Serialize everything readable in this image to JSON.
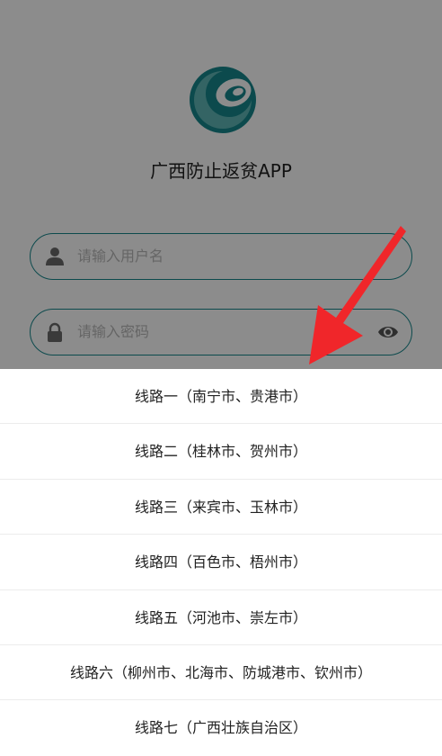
{
  "app": {
    "title": "广西防止返贫APP",
    "logo_icon": "app-logo-icon",
    "brand_color": "#17888c"
  },
  "login": {
    "username_placeholder": "请输入用户名",
    "password_placeholder": "请输入密码",
    "username_icon": "user-icon",
    "password_icon": "lock-icon",
    "visibility_icon": "eye-icon"
  },
  "route_sheet": {
    "items": [
      {
        "label": "线路一（南宁市、贵港市）"
      },
      {
        "label": "线路二（桂林市、贺州市）"
      },
      {
        "label": "线路三（来宾市、玉林市）"
      },
      {
        "label": "线路四（百色市、梧州市）"
      },
      {
        "label": "线路五（河池市、崇左市）"
      },
      {
        "label": "线路六（柳州市、北海市、防城港市、钦州市）"
      },
      {
        "label": "线路七（广西壮族自治区）"
      }
    ]
  },
  "annotation": {
    "arrow_icon": "red-arrow-icon",
    "arrow_color": "#f0262a"
  }
}
